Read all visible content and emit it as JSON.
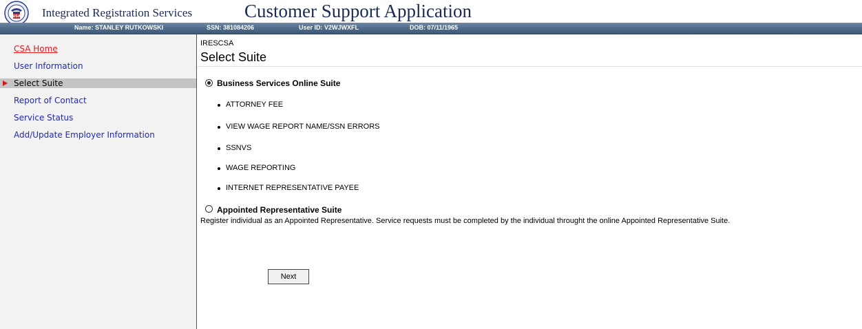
{
  "header": {
    "app_name": "Integrated Registration Services",
    "page_heading": "Customer Support Application",
    "logo": {
      "icon": "ssa-seal-icon",
      "seal_text": "USA"
    }
  },
  "userbar": {
    "name": "Name: STANLEY RUTKOWSKI",
    "ssn": "SSN: 381084206",
    "user_id": "User ID: V2WJWXFL",
    "dob": "DOB: 07/11/1965"
  },
  "sidebar": {
    "items": [
      {
        "label": "CSA Home"
      },
      {
        "label": "User Information"
      },
      {
        "label": "Select Suite",
        "active": true
      },
      {
        "label": "Report of Contact"
      },
      {
        "label": "Service Status"
      },
      {
        "label": "Add/Update Employer Information"
      }
    ]
  },
  "main": {
    "system_code": "IRESCSA",
    "title": "Select Suite",
    "suites": [
      {
        "label": "Business Services Online Suite",
        "selected": true,
        "services": [
          "ATTORNEY FEE",
          "VIEW WAGE REPORT NAME/SSN ERRORS",
          "SSNVS",
          "WAGE REPORTING",
          "INTERNET REPRESENTATIVE PAYEE"
        ]
      },
      {
        "label": "Appointed Representative Suite",
        "selected": false,
        "description": "Register individual as an Appointed Representative. Service requests must be completed by the individual throught the online Appointed Representative Suite."
      }
    ],
    "next_label": "Next"
  },
  "colors": {
    "userbar": "#526e8e",
    "link": "#1f29b8",
    "home_link": "#e8191e",
    "heading": "#1a2a55",
    "sidebar_bg": "#f2f2f2",
    "active_item_bg": "#c4c4c4",
    "sidebar_border": "#3b47c8"
  }
}
